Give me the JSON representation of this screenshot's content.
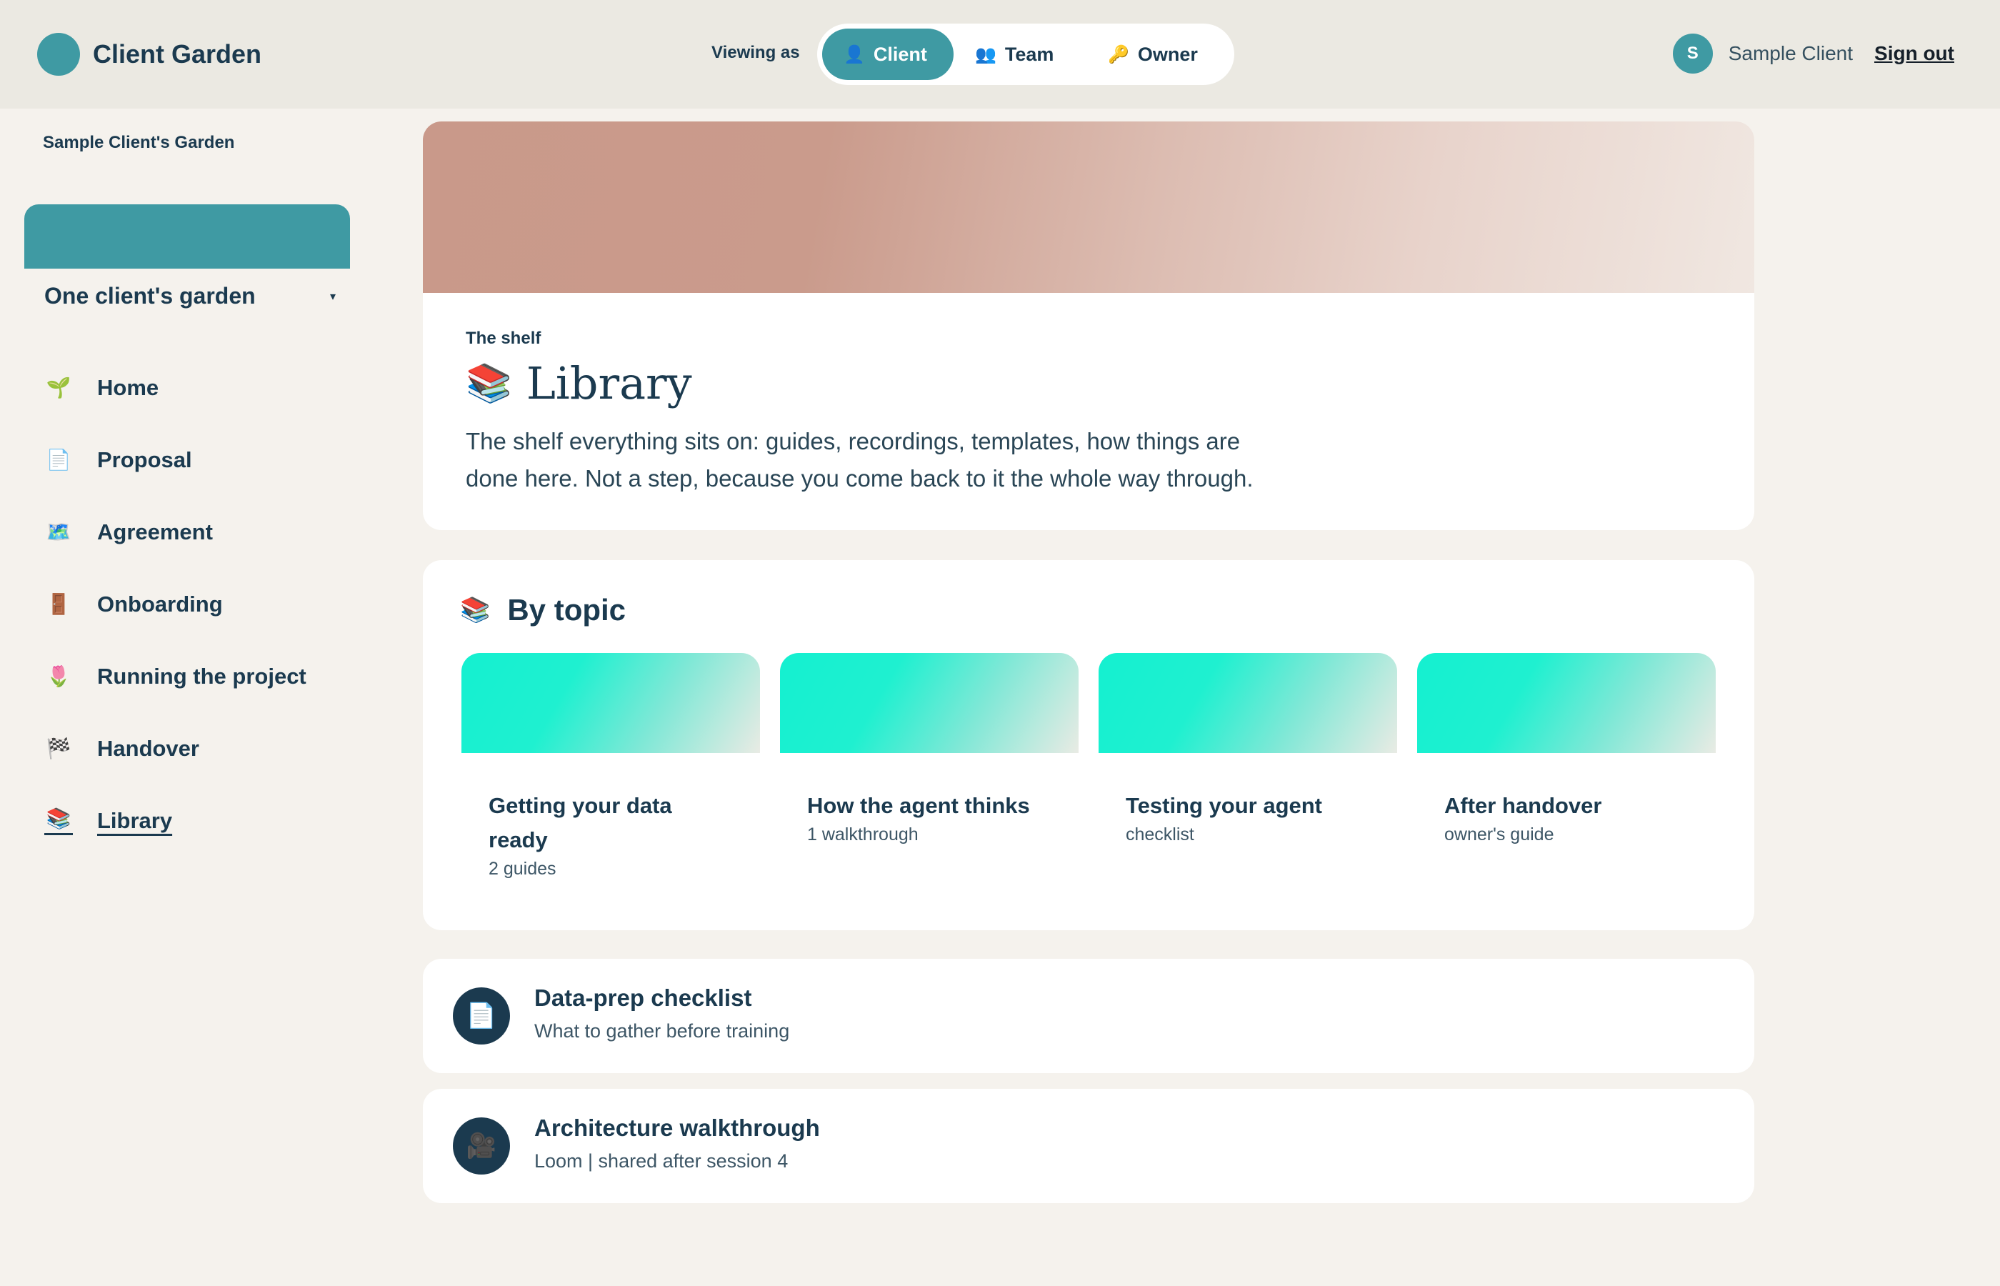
{
  "header": {
    "brand": "Client Garden",
    "viewing_label": "Viewing as",
    "roles": [
      {
        "icon": "👤",
        "label": "Client",
        "active": true
      },
      {
        "icon": "👥",
        "label": "Team",
        "active": false
      },
      {
        "icon": "🔑",
        "label": "Owner",
        "active": false
      }
    ],
    "user": {
      "initial": "S",
      "name": "Sample Client"
    },
    "sign_out": "Sign out"
  },
  "sidebar": {
    "owner_label": "Sample Client's Garden",
    "garden_select": "One client's garden",
    "caret": "▾",
    "items": [
      {
        "icon": "🌱",
        "label": "Home"
      },
      {
        "icon": "📄",
        "label": "Proposal"
      },
      {
        "icon": "🗺️",
        "label": "Agreement"
      },
      {
        "icon": "🚪",
        "label": "Onboarding"
      },
      {
        "icon": "🌷",
        "label": "Running the project"
      },
      {
        "icon": "🏁",
        "label": "Handover"
      },
      {
        "icon": "📚",
        "label": "Library",
        "active": true
      }
    ]
  },
  "hero": {
    "kicker": "The shelf",
    "icon": "📚",
    "title": "Library",
    "description": "The shelf everything sits on: guides, recordings, templates, how things are done here. Not a step, because you come back to it the whole way through."
  },
  "topics": {
    "icon": "📚",
    "heading": "By topic",
    "cards": [
      {
        "title": "Getting your data ready",
        "sub": "2 guides"
      },
      {
        "title": "How the agent thinks",
        "sub": "1 walkthrough"
      },
      {
        "title": "Testing your agent",
        "sub": "checklist"
      },
      {
        "title": "After handover",
        "sub": "owner's guide"
      }
    ]
  },
  "resources": [
    {
      "icon": "📄",
      "title": "Data-prep checklist",
      "sub": "What to gather before training"
    },
    {
      "icon": "🎥",
      "title": "Architecture walkthrough",
      "sub": "Loom | shared after session 4"
    }
  ],
  "colors": {
    "teal": "#3f9aa3",
    "navy": "#1b3a4f",
    "page_bg": "#f5f2ed",
    "header_bg": "#ebe9e2"
  }
}
